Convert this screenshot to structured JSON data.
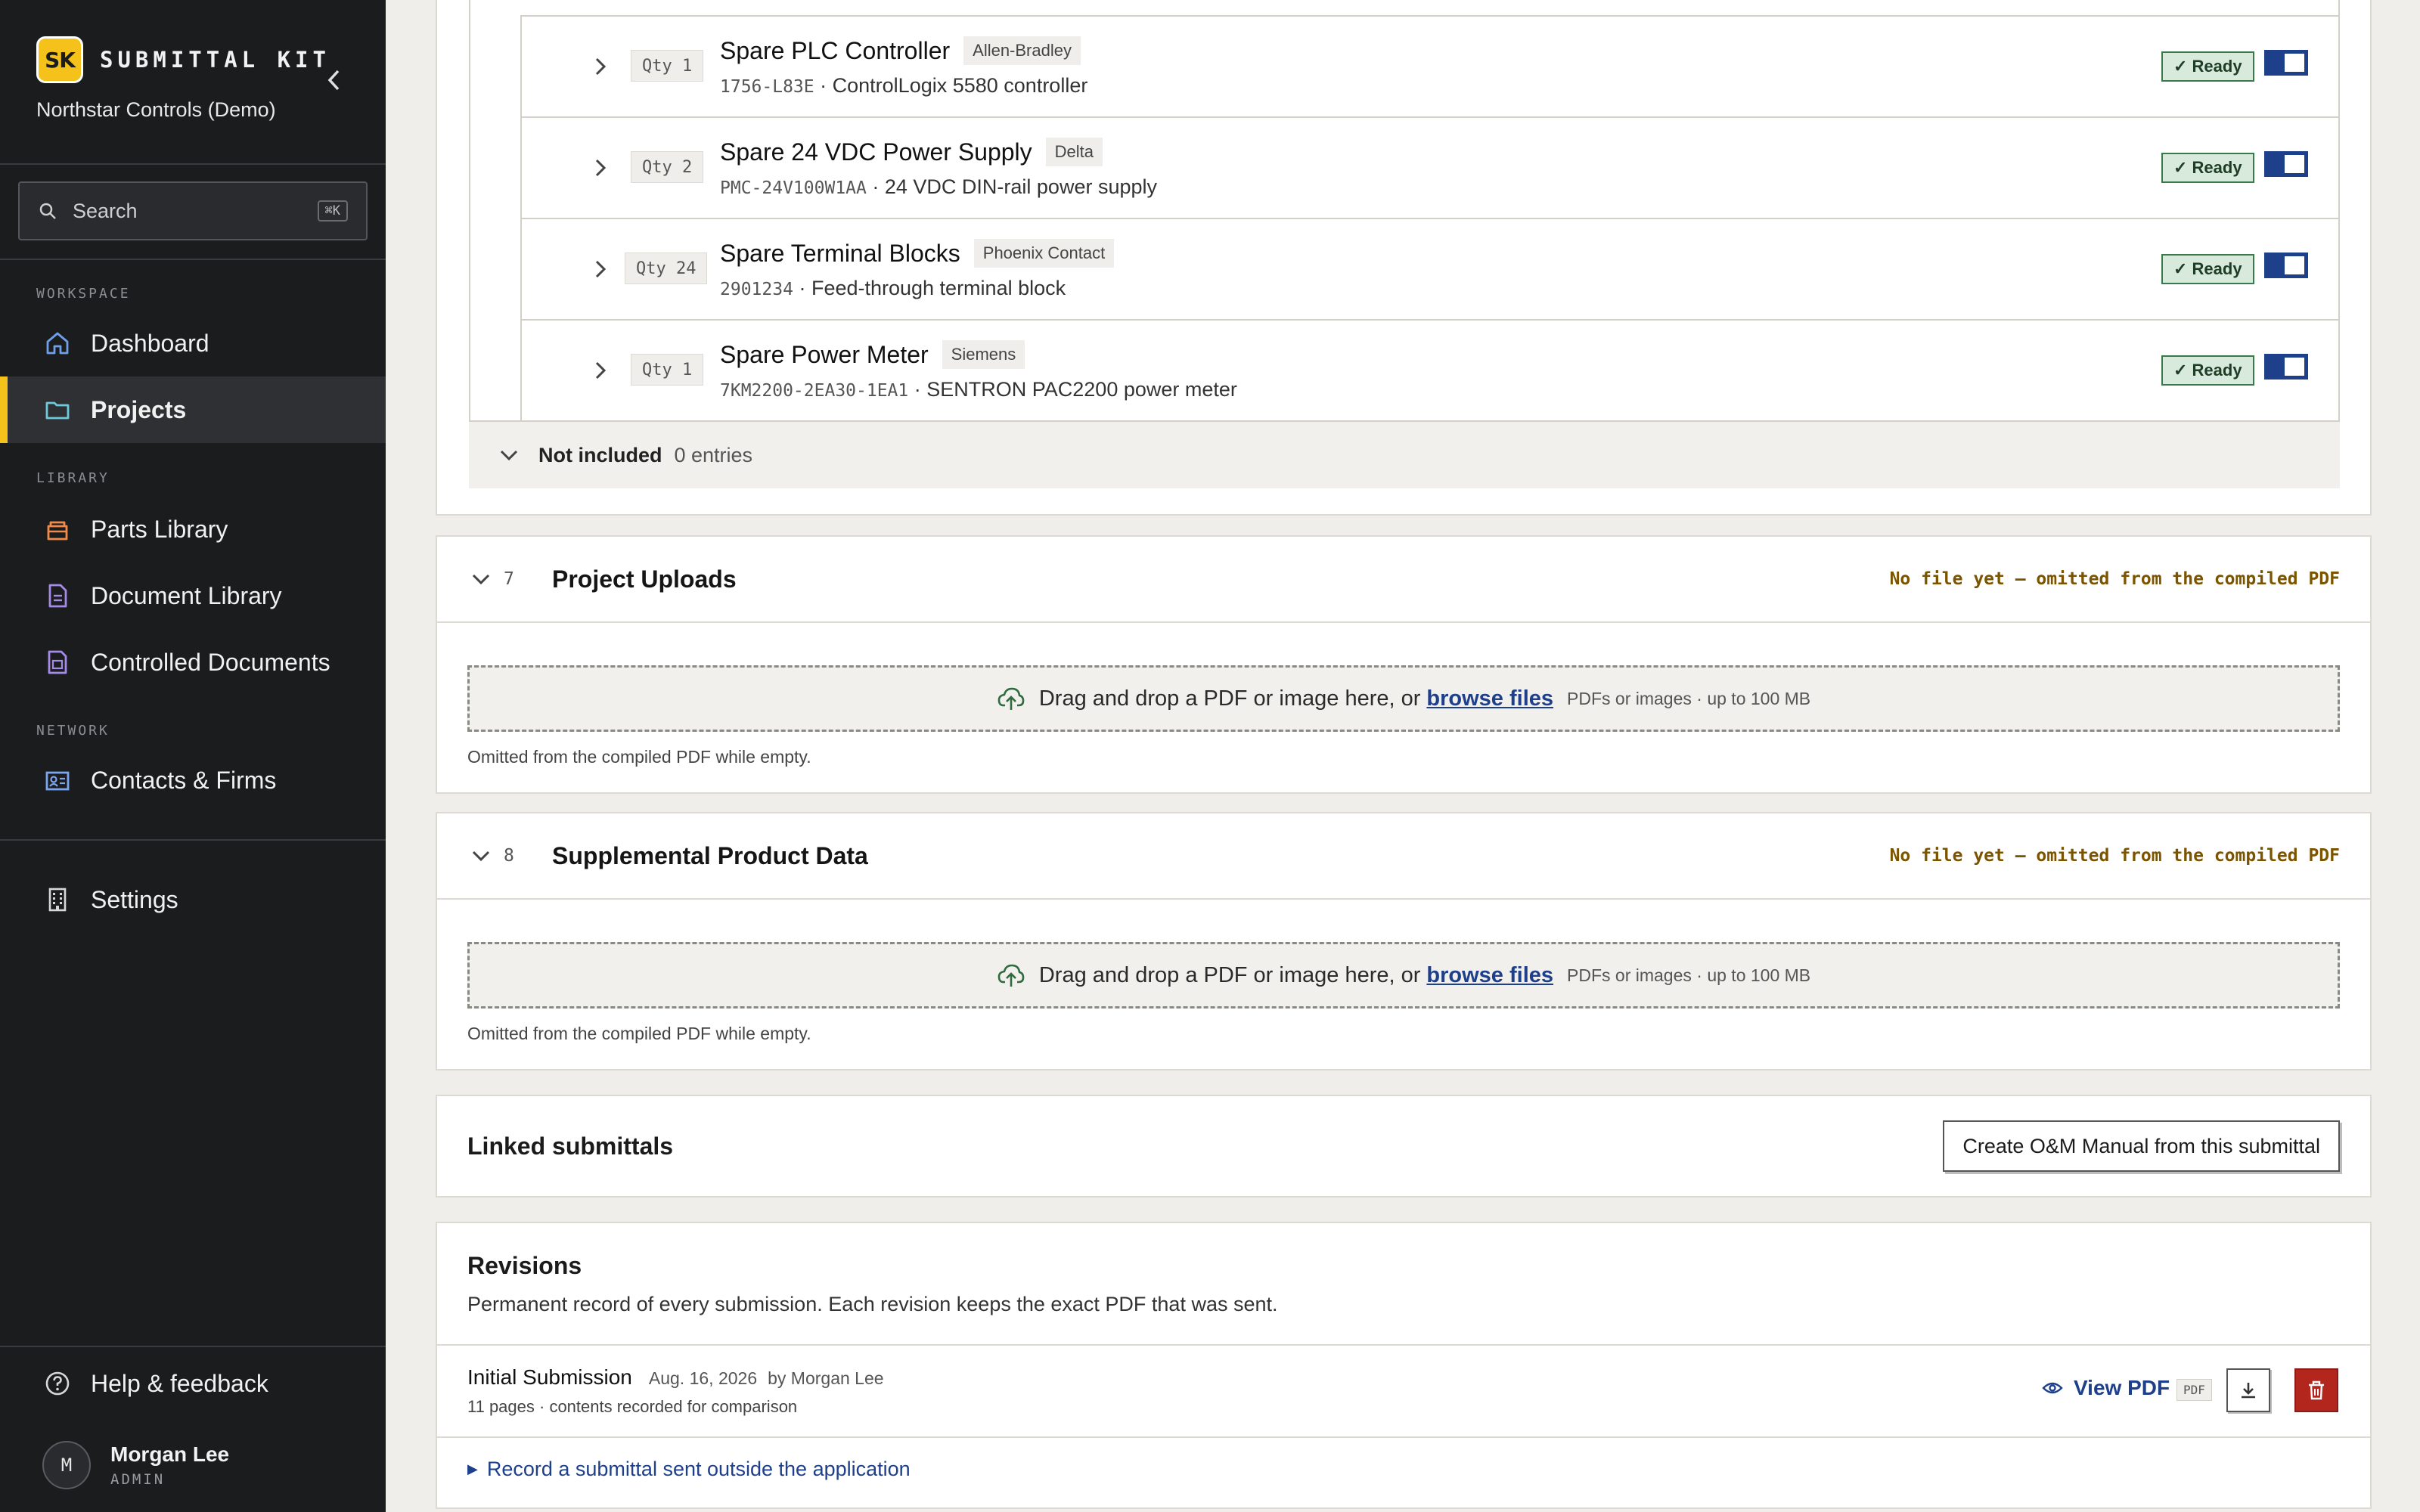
{
  "app": {
    "brand_logo": "SK",
    "brand_name": "SUBMITTAL KIT",
    "org_name": "Northstar Controls (Demo)"
  },
  "search": {
    "placeholder": "Search",
    "shortcut": "⌘K"
  },
  "sidebar": {
    "sections": {
      "workspace": "WORKSPACE",
      "library": "LIBRARY",
      "network": "NETWORK"
    },
    "items": {
      "dashboard": "Dashboard",
      "projects": "Projects",
      "parts_library": "Parts Library",
      "document_library": "Document Library",
      "controlled_documents": "Controlled Documents",
      "contacts_firms": "Contacts & Firms",
      "settings": "Settings",
      "help": "Help & feedback"
    },
    "active_item": "projects",
    "accent_color": "#f4c21b"
  },
  "user": {
    "initial": "M",
    "name": "Morgan Lee",
    "role": "ADMIN"
  },
  "items": [
    {
      "qty": "Qty 1",
      "name": "Spare PLC Controller",
      "vendor": "Allen-Bradley",
      "part_number": "1756-L83E",
      "description": "· ControlLogix 5580 controller",
      "status": "✓ Ready",
      "included": true
    },
    {
      "qty": "Qty 2",
      "name": "Spare 24 VDC Power Supply",
      "vendor": "Delta",
      "part_number": "PMC-24V100W1AA",
      "description": "· 24 VDC DIN-rail power supply",
      "status": "✓ Ready",
      "included": true
    },
    {
      "qty": "Qty 24",
      "name": "Spare Terminal Blocks",
      "vendor": "Phoenix Contact",
      "part_number": "2901234",
      "description": "· Feed-through terminal block",
      "status": "✓ Ready",
      "included": true
    },
    {
      "qty": "Qty 1",
      "name": "Spare Power Meter",
      "vendor": "Siemens",
      "part_number": "7KM2200-2EA30-1EA1",
      "description": "· SENTRON PAC2200 power meter",
      "status": "✓ Ready",
      "included": true
    }
  ],
  "not_included": {
    "label": "Not included",
    "count": "0 entries"
  },
  "sections": [
    {
      "number": "7",
      "title": "Project Uploads",
      "note": "No file yet — omitted from the compiled PDF",
      "drop_text": "Drag and drop a PDF or image here, or",
      "browse": "browse files",
      "hint": "PDFs or images · up to 100 MB",
      "omit_text": "Omitted from the compiled PDF while empty."
    },
    {
      "number": "8",
      "title": "Supplemental Product Data",
      "note": "No file yet — omitted from the compiled PDF",
      "drop_text": "Drag and drop a PDF or image here, or",
      "browse": "browse files",
      "hint": "PDFs or images · up to 100 MB",
      "omit_text": "Omitted from the compiled PDF while empty."
    }
  ],
  "linked": {
    "title": "Linked submittals",
    "button": "Create O&M Manual from this submittal"
  },
  "revisions": {
    "title": "Revisions",
    "description": "Permanent record of every submission. Each revision keeps the exact PDF that was sent.",
    "entries": [
      {
        "name": "Initial Submission",
        "date": "Aug. 16, 2026",
        "by": "by Morgan Lee",
        "meta": "11 pages · contents recorded for comparison",
        "view_label": "View PDF",
        "file_tag": "PDF"
      }
    ],
    "record_link": "Record a submittal sent outside the application"
  },
  "colors": {
    "primary": "#1e3f8a",
    "ready_bg": "#d8eadc",
    "danger": "#b3261e",
    "warning_text": "#7b5400"
  }
}
